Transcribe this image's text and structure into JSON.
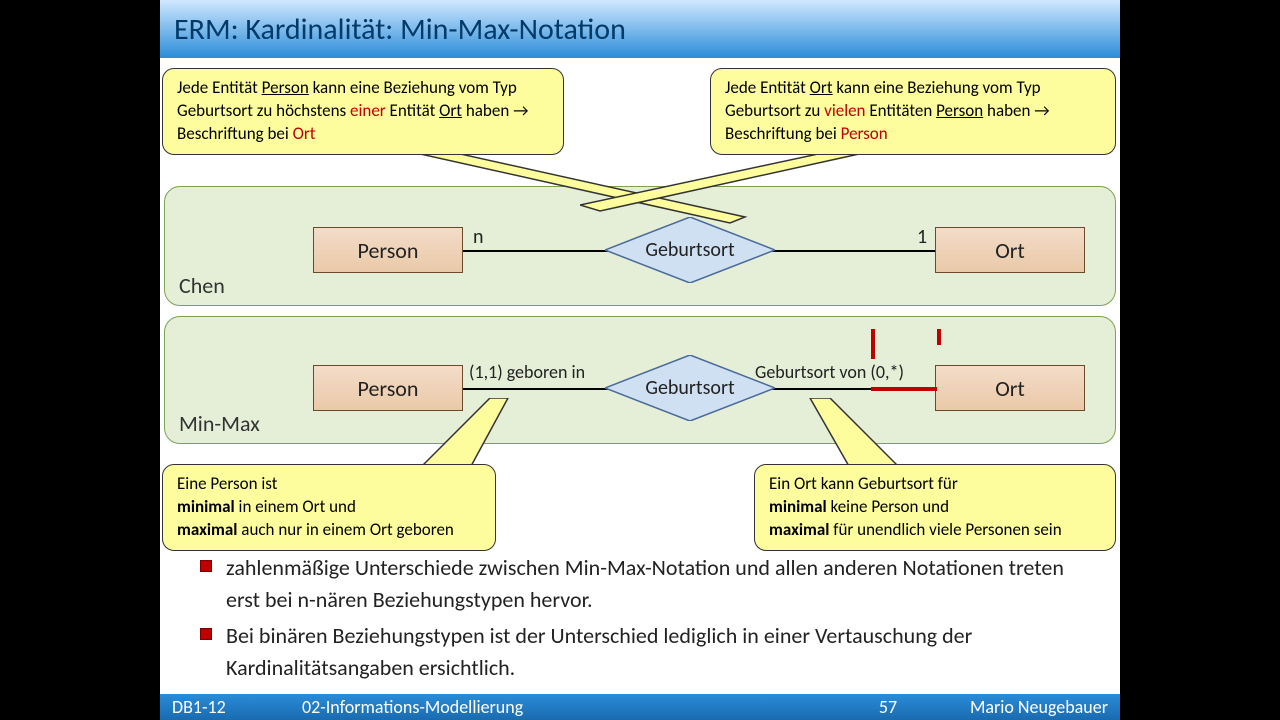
{
  "title": "ERM: Kardinalität: Min-Max-Notation",
  "callouts": {
    "topLeft": {
      "pre1": "Jede Entität ",
      "ulPerson": "Person",
      "post1": " kann eine Beziehung vom Typ Geburtsort zu höchstens ",
      "red1": "einer",
      "post2": " Entität ",
      "ulOrt": "Ort",
      "post3": " haben → Beschriftung bei ",
      "red2": "Ort"
    },
    "topRight": {
      "pre1": "Jede Entität ",
      "ulOrt": "Ort",
      "post1": " kann eine Beziehung vom Typ Geburtsort zu ",
      "red1": "vielen",
      "post2": " Entitäten ",
      "ulPerson": "Person",
      "post3": " haben → Beschriftung bei ",
      "red2": "Person"
    },
    "bottomLeft": {
      "l1a": "Eine Person ist",
      "b1": "minimal",
      "l2": " in einem Ort und",
      "b2": "maximal",
      "l3": " auch nur in einem Ort geboren"
    },
    "bottomRight": {
      "l1a": "Ein Ort kann Geburtsort für",
      "b1": "minimal",
      "l2": " keine Person und",
      "b2": "maximal",
      "l3": " für unendlich viele Personen sein"
    }
  },
  "chen": {
    "label": "Chen",
    "entityL": "Person",
    "entityR": "Ort",
    "relation": "Geburtsort",
    "cardL": "n",
    "cardR": "1"
  },
  "minmax": {
    "label": "Min-Max",
    "entityL": "Person",
    "entityR": "Ort",
    "relation": "Geburtsort",
    "labelL": "(1,1) geboren in",
    "labelR": "Geburtsort von (0,*)"
  },
  "bullets": {
    "b1": "zahlenmäßige Unterschiede zwischen Min-Max-Notation und allen anderen Notationen treten erst bei n-nären Beziehungstypen hervor.",
    "b2": "Bei binären Beziehungstypen ist der Unterschied lediglich in einer Vertauschung der Kardinalitätsangaben ersichtlich."
  },
  "footer": {
    "left": "DB1-12",
    "mid": "02-Informations-Modellierung",
    "page": "57",
    "author": "Mario Neugebauer"
  }
}
